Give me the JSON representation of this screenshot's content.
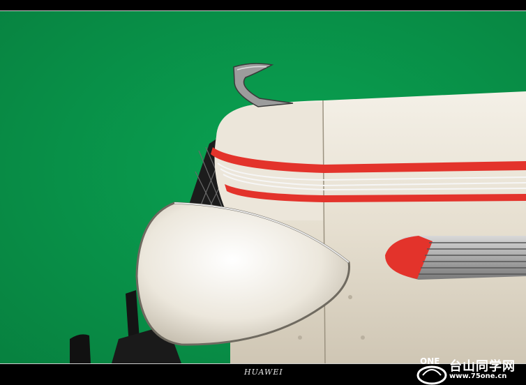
{
  "image": {
    "caption": "HUAWEI",
    "subject": "hood-ornament",
    "background_color": "#07984d",
    "car_body_color": "#e6dfd0",
    "accent_stripe_color": "#e3332b"
  },
  "watermark": {
    "brand_mark": "ONE",
    "title": "台山同学网",
    "url": "www.75one.cn"
  }
}
